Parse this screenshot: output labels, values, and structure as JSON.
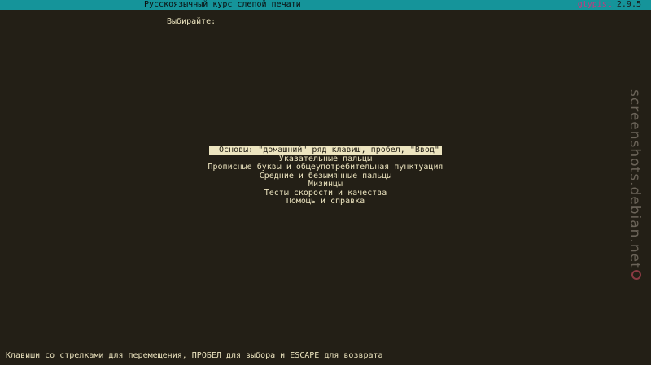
{
  "header": {
    "title": "Русскоязычный курс слепой печати",
    "program_name": "gtypist",
    "version": "2.9.5"
  },
  "prompt": "Выбирайте:",
  "menu": {
    "items": [
      {
        "label": "Основы: \"домашний\" ряд клавиш, пробел, \"Ввод\"",
        "selected": true
      },
      {
        "label": "Указательные пальцы",
        "selected": false
      },
      {
        "label": "Прописные буквы и общеупотребительная пунктуация",
        "selected": false
      },
      {
        "label": "Средние и безымянные пальцы",
        "selected": false
      },
      {
        "label": "Мизинцы",
        "selected": false
      },
      {
        "label": "Тесты скорости и качества",
        "selected": false
      },
      {
        "label": "Помощь и справка",
        "selected": false
      }
    ]
  },
  "footer": {
    "hint": "Клавиши со стрелками для перемещения, ПРОБЕЛ для выбора и ESCAPE для возврата"
  },
  "watermark": {
    "text": "screenshots.debian.net",
    "icon": "debian-swirl-icon"
  },
  "colors": {
    "background": "#231f16",
    "titlebar": "#15949a",
    "text": "#ece4bf",
    "selected_bg": "#ece4bf",
    "program_name": "#c4387f"
  }
}
